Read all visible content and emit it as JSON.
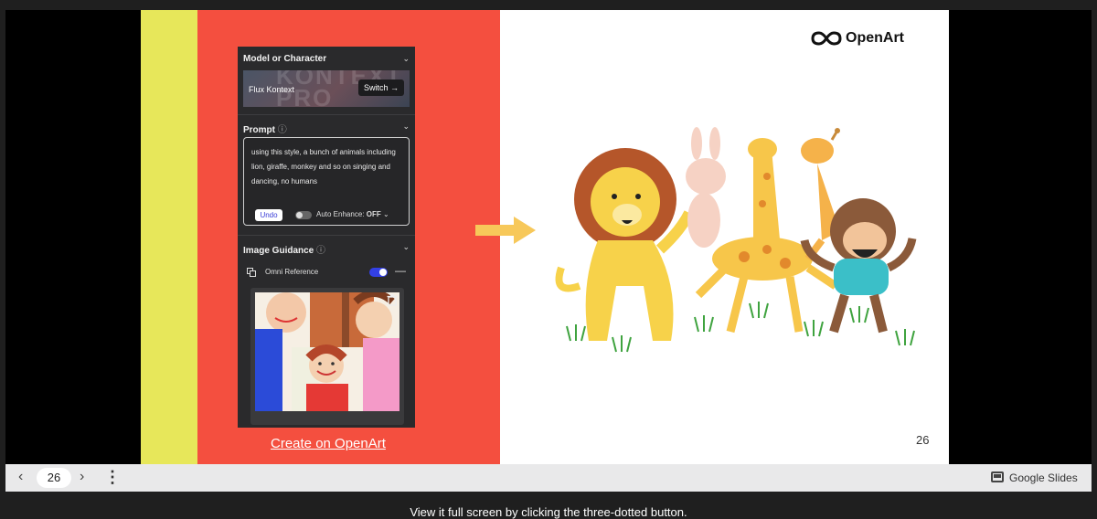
{
  "panel": {
    "model_section_title": "Model or Character",
    "model_name": "Flux Kontext",
    "banner_text": "KONTEXT PRO",
    "switch_label": "Switch",
    "prompt_section_title": "Prompt",
    "prompt_text": "using this style, a bunch of animals including lion, giraffe, monkey and so on singing and dancing, no humans",
    "undo_label": "Undo",
    "auto_enhance_label": "Auto Enhance:",
    "auto_enhance_value": "OFF",
    "guidance_section_title": "Image Guidance",
    "omni_reference_label": "Omni Reference",
    "omni_reference_enabled": true
  },
  "slide": {
    "create_link": "Create on OpenArt",
    "logo_text": "OpenArt",
    "slide_number": "26"
  },
  "bottom_bar": {
    "current_page": "26",
    "app_label": "Google Slides"
  },
  "caption": "View it full screen by clicking the three-dotted button.",
  "colors": {
    "yellow_band": "#e7e75a",
    "red_panel": "#f44f3f",
    "arrow": "#f7c85a",
    "toggle_on": "#3340e6"
  }
}
